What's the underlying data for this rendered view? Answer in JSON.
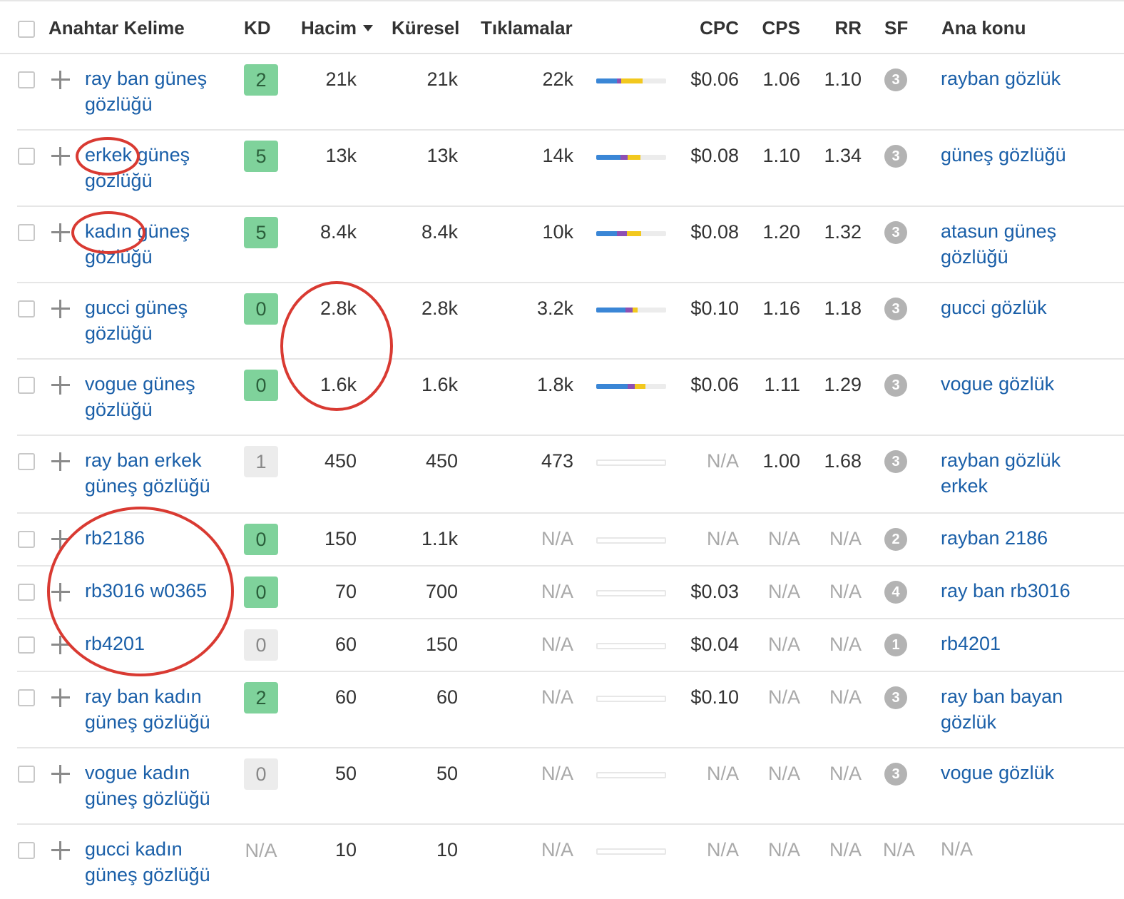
{
  "header": {
    "keyword": "Anahtar Kelime",
    "kd": "KD",
    "volume": "Hacim",
    "global": "Küresel",
    "clicks": "Tıklamalar",
    "cpc": "CPC",
    "cps": "CPS",
    "rr": "RR",
    "sf": "SF",
    "parent": "Ana konu"
  },
  "colors": {
    "blue": "#3a86d6",
    "purple": "#8e50b3",
    "yellow": "#f2c81e",
    "kd_green": "#7fd29b",
    "link": "#1a5fa8",
    "annotation_red": "#d93a32"
  },
  "rows": [
    {
      "keyword": "ray ban güneş gözlüğü",
      "kd": "2",
      "kd_style": "green",
      "volume": "21k",
      "global": "21k",
      "clicks": "22k",
      "cpc": "$0.06",
      "cps": "1.06",
      "rr": "1.10",
      "sf": "3",
      "parent": "rayban gözlük",
      "bar": [
        0.3,
        0.06,
        0.3
      ]
    },
    {
      "keyword": "erkek güneş gözlüğü",
      "kd": "5",
      "kd_style": "green",
      "volume": "13k",
      "global": "13k",
      "clicks": "14k",
      "cpc": "$0.08",
      "cps": "1.10",
      "rr": "1.34",
      "sf": "3",
      "parent": "güneş gözlüğü",
      "bar": [
        0.35,
        0.1,
        0.18
      ]
    },
    {
      "keyword": "kadın güneş gözlüğü",
      "kd": "5",
      "kd_style": "green",
      "volume": "8.4k",
      "global": "8.4k",
      "clicks": "10k",
      "cpc": "$0.08",
      "cps": "1.20",
      "rr": "1.32",
      "sf": "3",
      "parent": "atasun güneş gözlüğü",
      "bar": [
        0.3,
        0.14,
        0.2
      ]
    },
    {
      "keyword": "gucci güneş gözlüğü",
      "kd": "0",
      "kd_style": "green",
      "volume": "2.8k",
      "global": "2.8k",
      "clicks": "3.2k",
      "cpc": "$0.10",
      "cps": "1.16",
      "rr": "1.18",
      "sf": "3",
      "parent": "gucci gözlük",
      "bar": [
        0.42,
        0.1,
        0.07
      ]
    },
    {
      "keyword": "vogue güneş gözlüğü",
      "kd": "0",
      "kd_style": "green",
      "volume": "1.6k",
      "global": "1.6k",
      "clicks": "1.8k",
      "cpc": "$0.06",
      "cps": "1.11",
      "rr": "1.29",
      "sf": "3",
      "parent": "vogue gözlük",
      "bar": [
        0.45,
        0.1,
        0.15
      ]
    },
    {
      "keyword": "ray ban erkek güneş gözlüğü",
      "kd": "1",
      "kd_style": "grey",
      "volume": "450",
      "global": "450",
      "clicks": "473",
      "cpc": "N/A",
      "cps": "1.00",
      "rr": "1.68",
      "sf": "3",
      "parent": "rayban gözlük erkek",
      "bar": null
    },
    {
      "keyword": "rb2186",
      "kd": "0",
      "kd_style": "green",
      "volume": "150",
      "global": "1.1k",
      "clicks": "N/A",
      "cpc": "N/A",
      "cps": "N/A",
      "rr": "N/A",
      "sf": "2",
      "parent": "rayban 2186",
      "bar": null
    },
    {
      "keyword": "rb3016 w0365",
      "kd": "0",
      "kd_style": "green",
      "volume": "70",
      "global": "700",
      "clicks": "N/A",
      "cpc": "$0.03",
      "cps": "N/A",
      "rr": "N/A",
      "sf": "4",
      "parent": "ray ban rb3016",
      "bar": null
    },
    {
      "keyword": "rb4201",
      "kd": "0",
      "kd_style": "grey",
      "volume": "60",
      "global": "150",
      "clicks": "N/A",
      "cpc": "$0.04",
      "cps": "N/A",
      "rr": "N/A",
      "sf": "1",
      "parent": "rb4201",
      "bar": null
    },
    {
      "keyword": "ray ban kadın güneş gözlüğü",
      "kd": "2",
      "kd_style": "green",
      "volume": "60",
      "global": "60",
      "clicks": "N/A",
      "cpc": "$0.10",
      "cps": "N/A",
      "rr": "N/A",
      "sf": "3",
      "parent": "ray ban bayan gözlük",
      "bar": null
    },
    {
      "keyword": "vogue kadın güneş gözlüğü",
      "kd": "0",
      "kd_style": "grey",
      "volume": "50",
      "global": "50",
      "clicks": "N/A",
      "cpc": "N/A",
      "cps": "N/A",
      "rr": "N/A",
      "sf": "3",
      "parent": "vogue gözlük",
      "bar": null
    },
    {
      "keyword": "gucci kadın güneş gözlüğü",
      "kd": "N/A",
      "kd_style": "none",
      "volume": "10",
      "global": "10",
      "clicks": "N/A",
      "cpc": "N/A",
      "cps": "N/A",
      "rr": "N/A",
      "sf": "N/A",
      "parent": "N/A",
      "bar": null
    }
  ]
}
